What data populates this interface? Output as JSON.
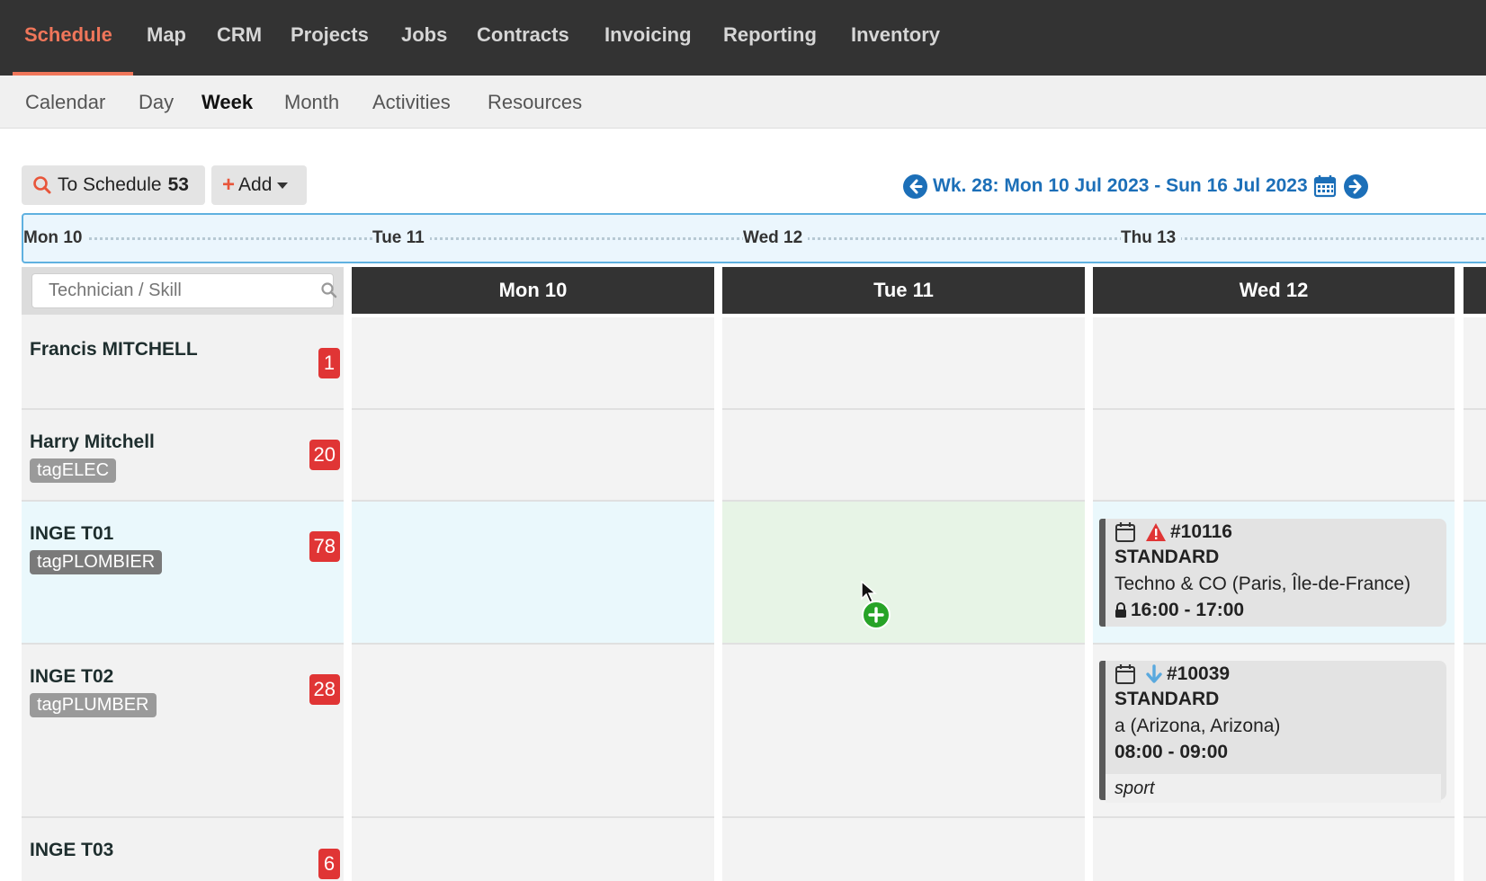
{
  "topnav": {
    "items": [
      "Schedule",
      "Map",
      "CRM",
      "Projects",
      "Jobs",
      "Contracts",
      "Invoicing",
      "Reporting",
      "Inventory"
    ],
    "active": "Schedule",
    "active_color": "#f0765a"
  },
  "subnav": {
    "items": [
      "Calendar",
      "Day",
      "Week",
      "Month",
      "Activities",
      "Resources"
    ],
    "active": "Week"
  },
  "toolbar": {
    "to_schedule_label": "To Schedule",
    "to_schedule_count": "53",
    "add_label": "Add",
    "week_label": "Wk. 28: Mon 10 Jul 2023 - Sun 16 Jul 2023",
    "icons": [
      "search-icon",
      "plus-icon",
      "caret-down-icon",
      "arrow-left-circle-icon",
      "calendar-icon",
      "arrow-right-circle-icon"
    ]
  },
  "timeline": {
    "days": [
      "Mon 10",
      "Tue 11",
      "Wed 12",
      "Thu 13"
    ]
  },
  "search": {
    "placeholder": "Technician / Skill"
  },
  "columns": [
    "Mon 10",
    "Tue 11",
    "Wed 12"
  ],
  "technicians": [
    {
      "name": "Francis MITCHELL",
      "tag": "",
      "count": "1"
    },
    {
      "name": "Harry Mitchell",
      "tag": "tagELEC",
      "tag_color": "#9a9a9a",
      "count": "20"
    },
    {
      "name": "INGE T01",
      "tag": "tagPLOMBIER",
      "tag_color": "#7a7a7a",
      "count": "78"
    },
    {
      "name": "INGE T02",
      "tag": "tagPLUMBER",
      "tag_color": "#9a9a9a",
      "count": "28"
    },
    {
      "name": "INGE T03",
      "tag": "",
      "count": "6"
    }
  ],
  "jobs": [
    {
      "number": "#10116",
      "type": "STANDARD",
      "customer": "Techno & CO (Paris, Île-de-France)",
      "time": "16:00 - 17:00",
      "icons": [
        "calendar-icon",
        "warning-icon",
        "lock-icon"
      ],
      "warning_color": "#e03535"
    },
    {
      "number": "#10039",
      "type": "STANDARD",
      "customer": "a (Arizona, Arizona)",
      "time": "08:00 - 09:00",
      "note": "sport",
      "icons": [
        "calendar-icon",
        "arrow-down-icon"
      ],
      "arrow_color": "#5aa9de"
    }
  ],
  "count_badge_color": "#e03535",
  "link_color": "#1c6fb8"
}
